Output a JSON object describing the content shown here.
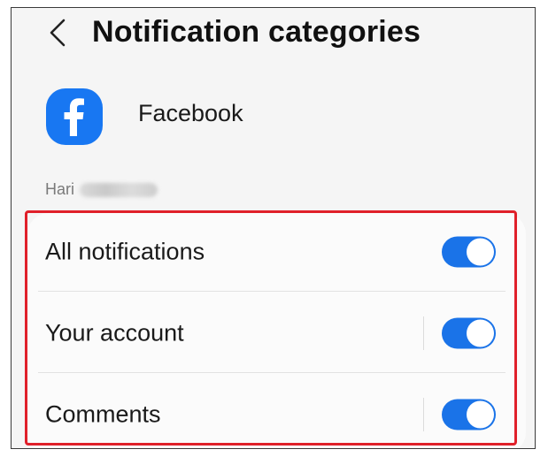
{
  "header": {
    "back_icon": "chevron-left-icon",
    "title": "Notification categories"
  },
  "app": {
    "icon": "facebook-icon",
    "name": "Facebook",
    "brand_color": "#1877F2"
  },
  "account": {
    "label": "Hari"
  },
  "categories": [
    {
      "label": "All notifications",
      "enabled": true
    },
    {
      "label": "Your account",
      "enabled": true
    },
    {
      "label": "Comments",
      "enabled": true
    }
  ],
  "colors": {
    "toggle_on": "#1a73e8",
    "highlight_border": "#e0202a"
  }
}
